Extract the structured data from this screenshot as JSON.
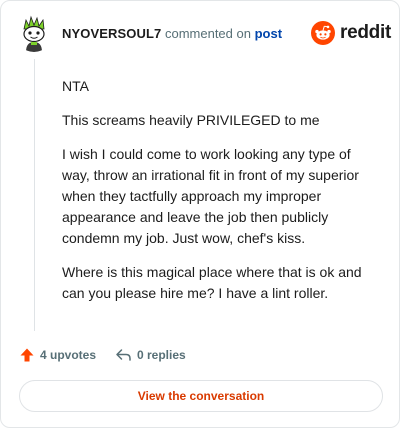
{
  "header": {
    "username": "NYOVERSOUL7",
    "action_text": "commented on",
    "post_link": "post",
    "brand_name": "reddit"
  },
  "comment": {
    "paragraphs": [
      "NTA",
      "This screams heavily PRIVILEGED to me",
      "I wish I could come to work looking any type of way, throw an irrational fit in front of my superior when they tactfully approach my improper appearance and leave the job then publicly condemn my job. Just wow, chef's kiss.",
      "Where is this magical place where that is ok and can you please hire me? I have a lint roller."
    ]
  },
  "footer": {
    "upvotes_label": "4 upvotes",
    "replies_label": "0 replies",
    "view_button": "View the conversation"
  },
  "colors": {
    "brand_orange": "#ff4500",
    "link_blue": "#0045ac",
    "button_text": "#d93a00",
    "avatar_green": "#7dd12b"
  },
  "icons": [
    "snoo-avatar-icon",
    "reddit-logo-icon",
    "upvote-arrow-icon",
    "reply-arrow-icon"
  ]
}
